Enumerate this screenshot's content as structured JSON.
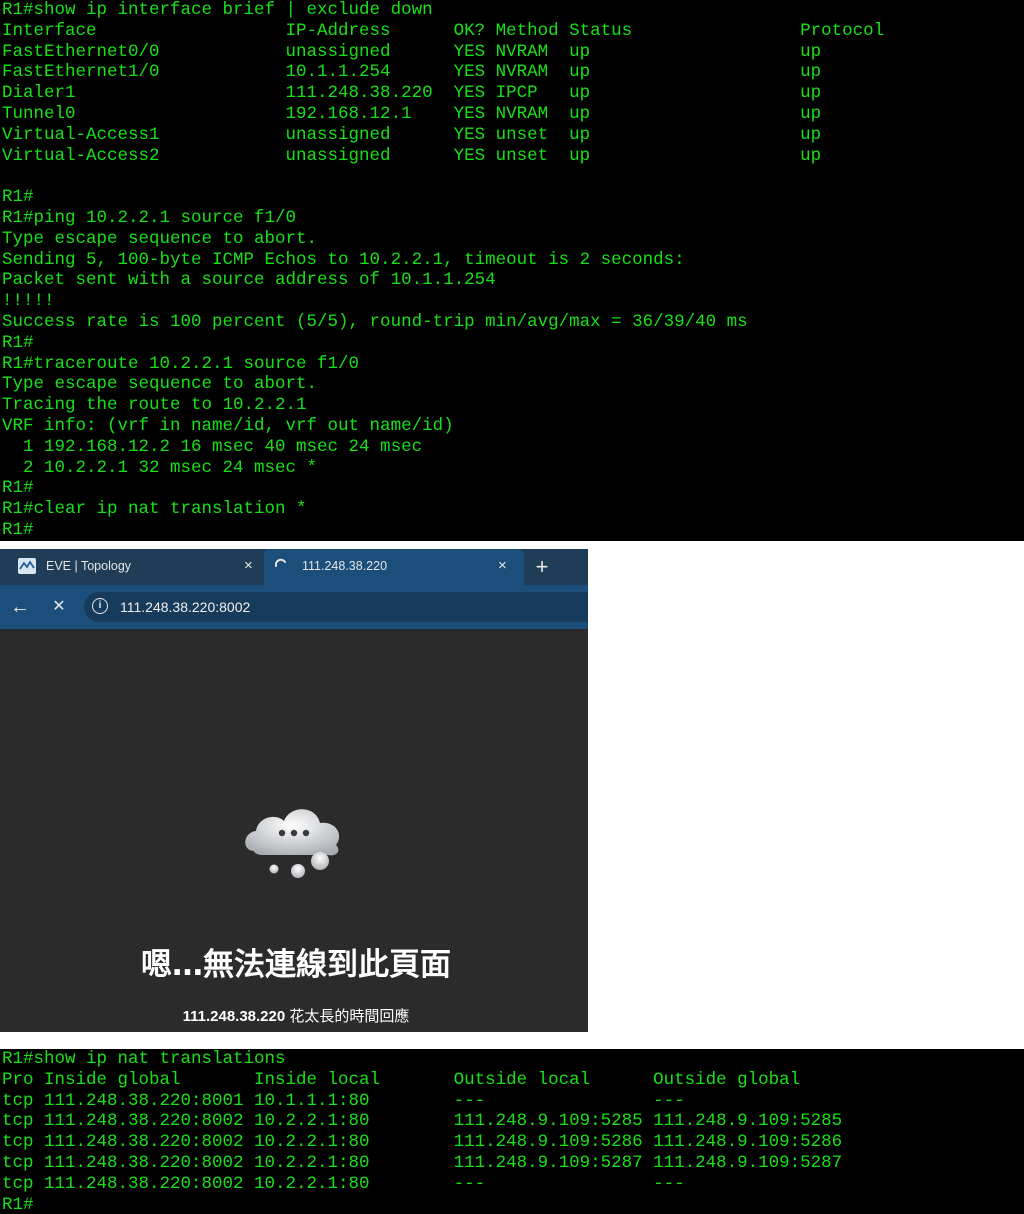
{
  "terminal_top": {
    "lines": [
      "R1#show ip interface brief | exclude down",
      "Interface                  IP-Address      OK? Method Status                Protocol",
      "FastEthernet0/0            unassigned      YES NVRAM  up                    up",
      "FastEthernet1/0            10.1.1.254      YES NVRAM  up                    up",
      "Dialer1                    111.248.38.220  YES IPCP   up                    up",
      "Tunnel0                    192.168.12.1    YES NVRAM  up                    up",
      "Virtual-Access1            unassigned      YES unset  up                    up",
      "Virtual-Access2            unassigned      YES unset  up                    up",
      "",
      "R1#",
      "R1#ping 10.2.2.1 source f1/0",
      "Type escape sequence to abort.",
      "Sending 5, 100-byte ICMP Echos to 10.2.2.1, timeout is 2 seconds:",
      "Packet sent with a source address of 10.1.1.254",
      "!!!!!",
      "Success rate is 100 percent (5/5), round-trip min/avg/max = 36/39/40 ms",
      "R1#",
      "R1#traceroute 10.2.2.1 source f1/0",
      "Type escape sequence to abort.",
      "Tracing the route to 10.2.2.1",
      "VRF info: (vrf in name/id, vrf out name/id)",
      "  1 192.168.12.2 16 msec 40 msec 24 msec",
      "  2 10.2.2.1 32 msec 24 msec *",
      "R1#",
      "R1#clear ip nat translation *",
      "R1#"
    ]
  },
  "browser": {
    "tabs": [
      {
        "label": "EVE | Topology",
        "icon": "eve-logo-icon",
        "close": "×"
      },
      {
        "label": "111.248.38.220",
        "icon": "loading-spinner-icon",
        "close": "×"
      }
    ],
    "new_tab": "+",
    "back": "←",
    "stop": "✕",
    "url": "111.248.38.220:8002",
    "error_title": "嗯…無法連線到此頁面",
    "error_host": "111.248.38.220",
    "error_detail": " 花太長的時間回應",
    "colors": {
      "tabbar": "#1f3d57",
      "active_tab": "#1b4e7a",
      "content_bg": "#2b2b2b"
    }
  },
  "terminal_bottom": {
    "lines": [
      "R1#show ip nat translations",
      "Pro Inside global       Inside local       Outside local      Outside global",
      "tcp 111.248.38.220:8001 10.1.1.1:80        ---                ---",
      "tcp 111.248.38.220:8002 10.2.2.1:80        111.248.9.109:5285 111.248.9.109:5285",
      "tcp 111.248.38.220:8002 10.2.2.1:80        111.248.9.109:5286 111.248.9.109:5286",
      "tcp 111.248.38.220:8002 10.2.2.1:80        111.248.9.109:5287 111.248.9.109:5287",
      "tcp 111.248.38.220:8002 10.2.2.1:80        ---                ---",
      "R1#"
    ]
  },
  "terminal_color": "#18e018"
}
